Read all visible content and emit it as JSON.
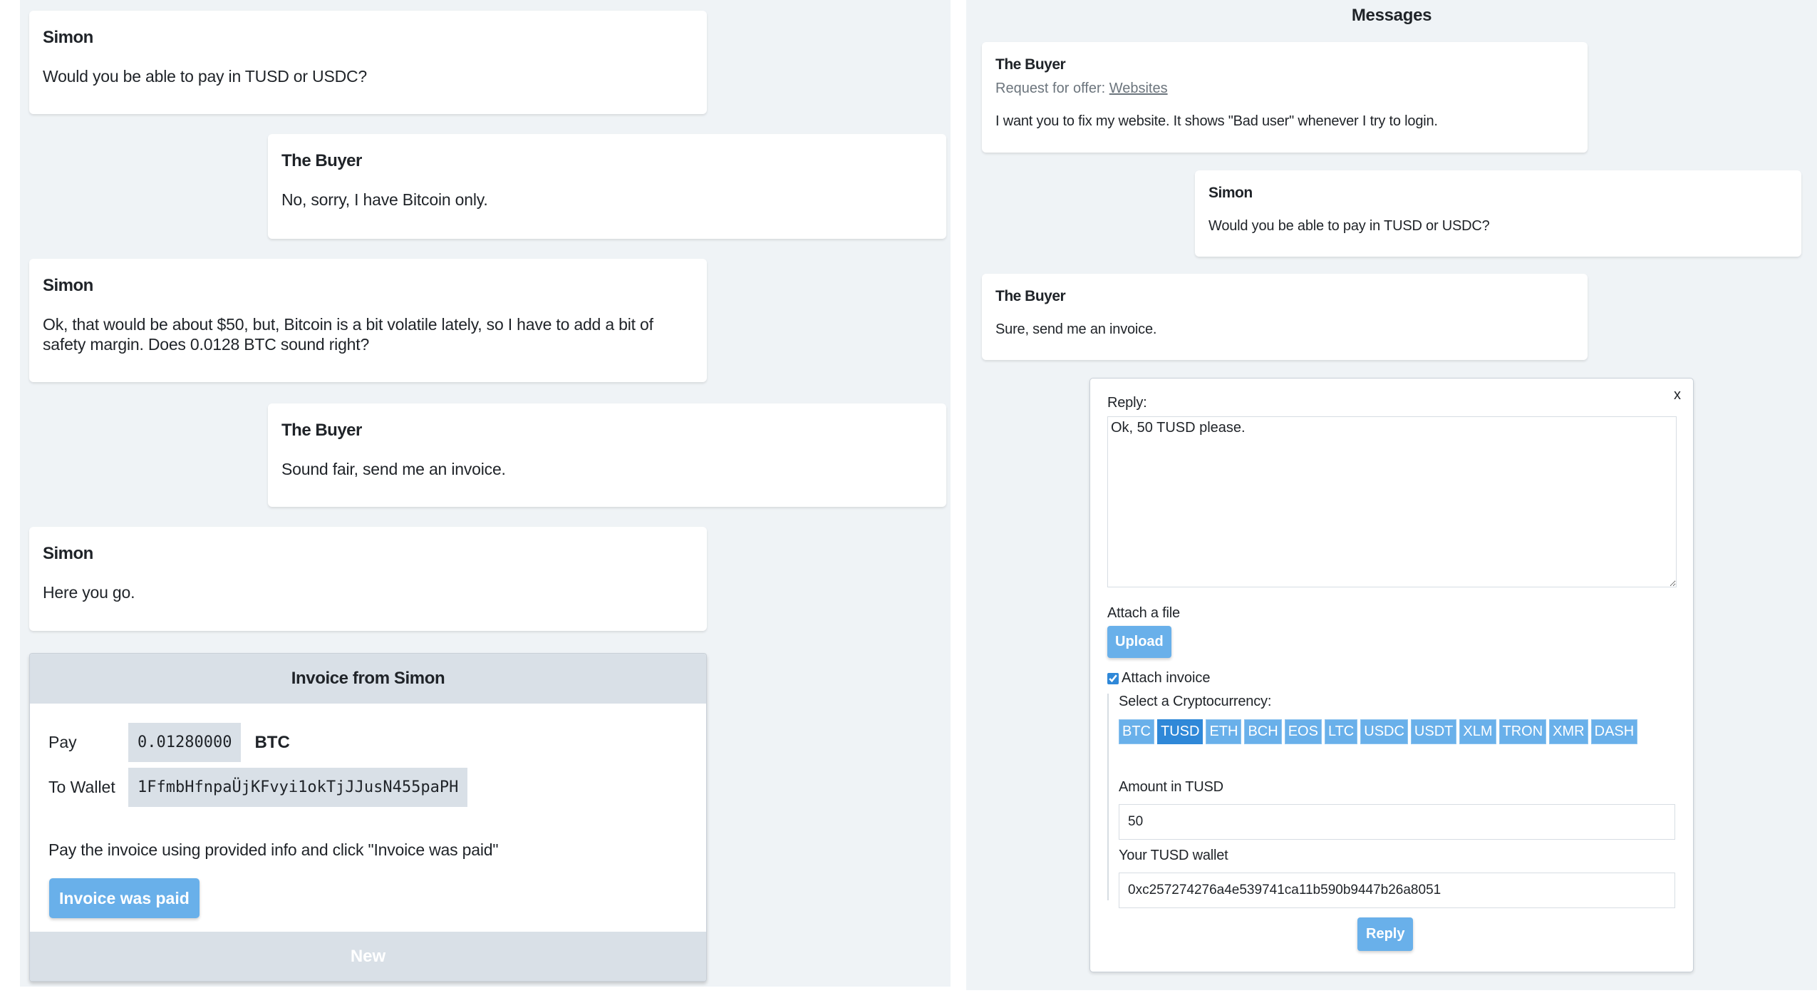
{
  "left": {
    "messages": [
      {
        "author": "Simon",
        "text": "Would you be able to pay in TUSD or USDC?"
      },
      {
        "author": "The Buyer",
        "text": "No, sorry, I have Bitcoin only."
      },
      {
        "author": "Simon",
        "text": "Ok, that would be about $50, but, Bitcoin is a bit volatile lately, so I have to add a bit of safety margin. Does 0.0128 BTC sound right?"
      },
      {
        "author": "The Buyer",
        "text": "Sound fair, send me an invoice."
      },
      {
        "author": "Simon",
        "text": "Here you go."
      }
    ],
    "invoice": {
      "title": "Invoice from Simon",
      "pay_label": "Pay",
      "pay_amount": "0.01280000",
      "pay_currency": "BTC",
      "wallet_label": "To Wallet",
      "wallet_address": "1FfmbHfnpaÜjKFvyi1okTjJJusN455paPH",
      "note": "Pay the invoice using provided info and click \"Invoice was paid\"",
      "paid_button": "Invoice was paid",
      "status": "New"
    }
  },
  "right": {
    "title": "Messages",
    "messages": [
      {
        "author": "The Buyer",
        "request_prefix": "Request for offer: ",
        "request_link": "Websites",
        "text": "I want you to fix my website. It shows \"Bad user\" whenever I try to login."
      },
      {
        "author": "Simon",
        "text": "Would you be able to pay in TUSD or USDC?"
      },
      {
        "author": "The Buyer",
        "text": "Sure, send me an invoice."
      }
    ],
    "reply_form": {
      "close_label": "x",
      "reply_label": "Reply:",
      "reply_value": "Ok, 50 TUSD please.",
      "attach_file_label": "Attach a file",
      "upload_button": "Upload",
      "attach_invoice_label": "Attach invoice",
      "attach_invoice_checked": true,
      "select_crypto_label": "Select a Cryptocurrency:",
      "cryptocurrencies": [
        "BTC",
        "TUSD",
        "ETH",
        "BCH",
        "EOS",
        "LTC",
        "USDC",
        "USDT",
        "XLM",
        "TRON",
        "XMR",
        "DASH"
      ],
      "selected_crypto": "TUSD",
      "amount_label": "Amount in TUSD",
      "amount_value": "50",
      "wallet_label": "Your TUSD wallet",
      "wallet_value": "0xc257274276a4e539741ca11b590b9447b26a8051",
      "submit_button": "Reply"
    }
  },
  "colors": {
    "panel_bg": "#eff3f6",
    "button_blue": "#69b0ea",
    "selected_blue": "#2f88d8",
    "invoice_header_bg": "#d9e0e7"
  }
}
